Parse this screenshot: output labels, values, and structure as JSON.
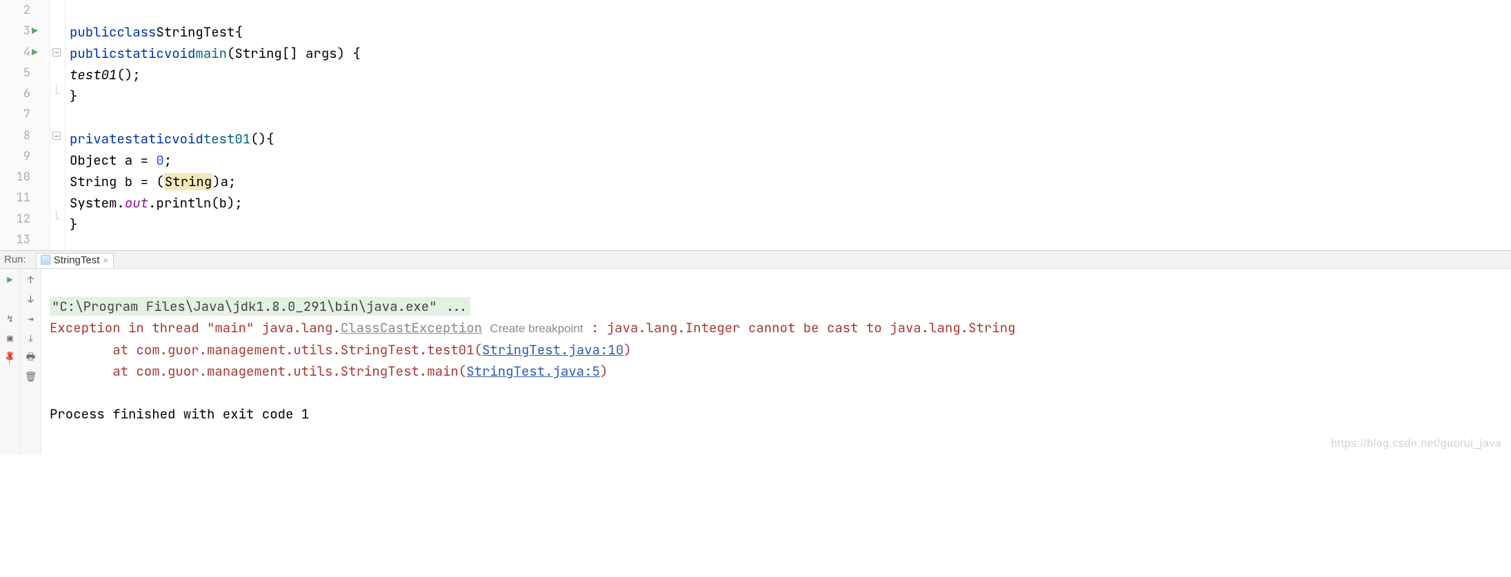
{
  "editor": {
    "line_numbers": [
      "2",
      "3",
      "4",
      "5",
      "6",
      "7",
      "8",
      "9",
      "10",
      "11",
      "12",
      "13"
    ],
    "run_icons_on_lines": [
      3,
      4
    ],
    "tokens": {
      "l3": {
        "kw1": "public",
        "kw2": "class",
        "name": "StringTest",
        "brace": "{"
      },
      "l4": {
        "kw1": "public",
        "kw2": "static",
        "kw3": "void",
        "mname": "main",
        "params": "(String[] args) {"
      },
      "l5": {
        "call": "test01",
        "paren": "();"
      },
      "l6": {
        "brace": "}"
      },
      "l8": {
        "kw1": "private",
        "kw2": "static",
        "kw3": "void",
        "mname": "test01",
        "paren": "(){"
      },
      "l9": {
        "text1": "Object a = ",
        "num": "0",
        "semi": ";"
      },
      "l10": {
        "text1": "String b = (",
        "hl": "String",
        "text2": ")a;"
      },
      "l11": {
        "text1": "System.",
        "field": "out",
        "text2": ".println(b);"
      },
      "l12": {
        "brace": "}"
      }
    }
  },
  "run_panel": {
    "label": "Run:",
    "tab_name": "StringTest"
  },
  "console": {
    "command": "\"C:\\Program Files\\Java\\jdk1.8.0_291\\bin\\java.exe\" ...",
    "exc_prefix": "Exception in thread \"main\" java.lang.",
    "exc_link": "ClassCastException",
    "create_bp": "Create breakpoint",
    "exc_suffix": " : java.lang.Integer cannot be cast to java.lang.String",
    "at1_prefix": "        at com.guor.management.utils.StringTest.test01(",
    "at1_link": "StringTest.java:10",
    "at1_suffix": ")",
    "at2_prefix": "        at com.guor.management.utils.StringTest.main(",
    "at2_link": "StringTest.java:5",
    "at2_suffix": ")",
    "exit": "Process finished with exit code 1"
  },
  "watermark": "https://blog.csdn.net/guorui_java"
}
